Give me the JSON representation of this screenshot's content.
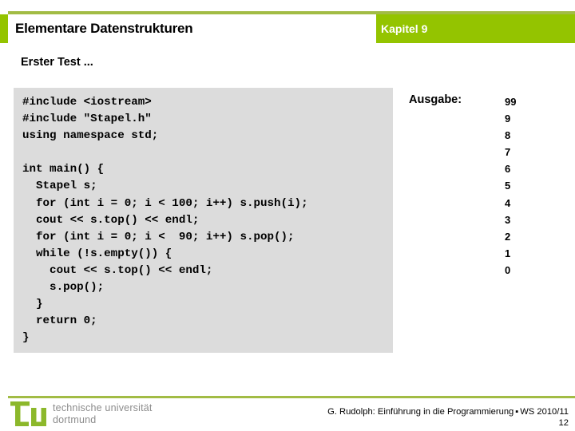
{
  "header": {
    "title": "Elementare Datenstrukturen",
    "chapter": "Kapitel 9",
    "band_color": "#94c400",
    "rule_color": "#a2bc45"
  },
  "subtitle": "Erster Test ...",
  "code": {
    "language": "cpp",
    "background_color": "#dcdcdc",
    "listing": "#include <iostream>\n#include \"Stapel.h\"\nusing namespace std;\n\nint main() {\n  Stapel s;\n  for (int i = 0; i < 100; i++) s.push(i);\n  cout << s.top() << endl;\n  for (int i = 0; i <  90; i++) s.pop();\n  while (!s.empty()) {\n    cout << s.top() << endl;\n    s.pop();\n  }\n  return 0;\n}"
  },
  "output": {
    "label": "Ausgabe:",
    "values": [
      "99",
      "9",
      "8",
      "7",
      "6",
      "5",
      "4",
      "3",
      "2",
      "1",
      "0"
    ]
  },
  "footer": {
    "logo_line1": "technische universität",
    "logo_line2": "dortmund",
    "logo_color": "#8cb82b",
    "credit_before": "G. Rudolph: Einführung in die Programmierung",
    "credit_separator": "▪",
    "credit_after": "WS 2010/11",
    "page_number": "12"
  }
}
